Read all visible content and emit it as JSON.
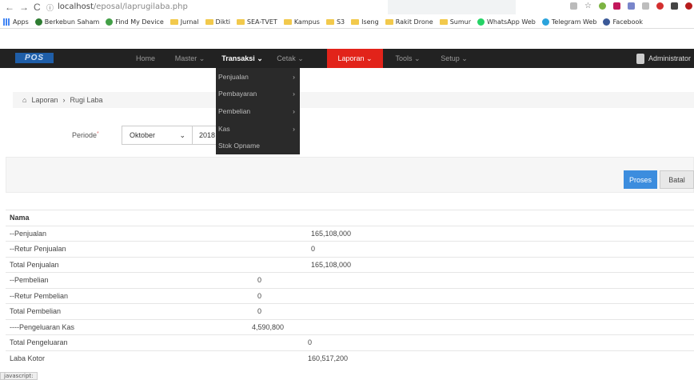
{
  "browser": {
    "url_host": "localhost",
    "url_path": "/eposal/laprugilaba.php",
    "bookmarks": [
      {
        "label": "Apps",
        "kind": "apps"
      },
      {
        "label": "Berkebun Saham",
        "kind": "site",
        "color": "#2e7d32"
      },
      {
        "label": "Find My Device",
        "kind": "site",
        "color": "#43a047"
      },
      {
        "label": "Jurnal",
        "kind": "folder"
      },
      {
        "label": "Dikti",
        "kind": "folder"
      },
      {
        "label": "SEA-TVET",
        "kind": "folder"
      },
      {
        "label": "Kampus",
        "kind": "folder"
      },
      {
        "label": "S3",
        "kind": "folder"
      },
      {
        "label": "Iseng",
        "kind": "folder"
      },
      {
        "label": "Rakit Drone",
        "kind": "folder"
      },
      {
        "label": "Sumur",
        "kind": "folder"
      },
      {
        "label": "WhatsApp Web",
        "kind": "site",
        "color": "#25d366"
      },
      {
        "label": "Telegram Web",
        "kind": "site",
        "color": "#2aa3dc"
      },
      {
        "label": "Facebook",
        "kind": "site",
        "color": "#3b5998"
      }
    ],
    "status_text": "javascript:"
  },
  "navbar": {
    "logo": "POS",
    "items": [
      "Home",
      "Master ⌄",
      "Transaksi ⌄",
      "Cetak ⌄",
      "Laporan ⌄",
      "Tools ⌄",
      "Setup ⌄"
    ],
    "user": "Administrator"
  },
  "dropdown": {
    "items": [
      "Penjualan",
      "Pembayaran",
      "Pembelian",
      "Kas",
      "Stok Opname"
    ],
    "submenu_marker": "›"
  },
  "breadcrumb": {
    "home": "Laporan",
    "separator": "›",
    "current": "Rugi Laba"
  },
  "form": {
    "periode_label": "Periode",
    "required_mark": "*",
    "month": "Oktober",
    "year": "2018",
    "proses": "Proses",
    "batal": "Batal"
  },
  "table": {
    "header": "Nama",
    "rows": [
      {
        "label": "--Penjualan",
        "value": "165,108,000",
        "col": 2
      },
      {
        "label": "--Retur Penjualan",
        "value": "0",
        "col": 2
      },
      {
        "label": "Total Penjualan",
        "value": "165,108,000",
        "col": 2
      },
      {
        "label": "--Pembelian",
        "value": "0",
        "col": 1
      },
      {
        "label": "--Retur Pembelian",
        "value": "0",
        "col": 1
      },
      {
        "label": "Total Pembelian",
        "value": "0",
        "col": 1
      },
      {
        "label": "----Pengeluaran Kas",
        "value": "4,590,800",
        "col": 1
      },
      {
        "label": "Total Pengeluaran",
        "value": "0",
        "col": 3
      },
      {
        "label": "Laba Kotor",
        "value": "160,517,200",
        "col": 3
      }
    ]
  },
  "colors": {
    "navbar": "#222222",
    "accent": "#e2231a",
    "primary": "#3c8dde"
  }
}
